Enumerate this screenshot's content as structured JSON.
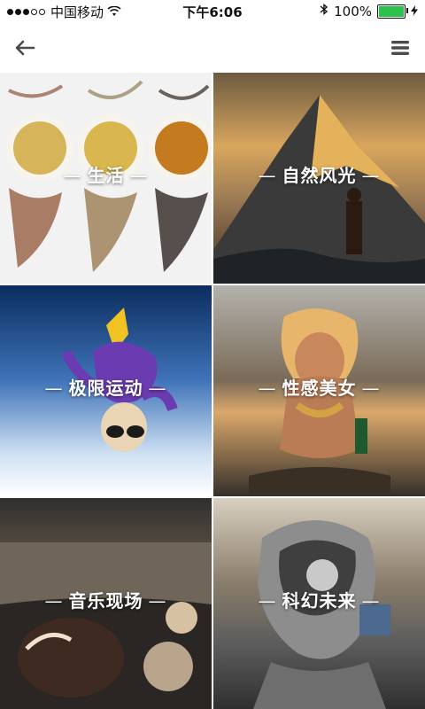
{
  "status_bar": {
    "carrier": "中国移动",
    "time": "下午6:06",
    "battery_percent": "100%",
    "battery_level": 1.0,
    "icons": [
      "signal-dots",
      "wifi",
      "bluetooth",
      "battery",
      "charging-bolt"
    ]
  },
  "nav": {
    "back_icon": "back-arrow-icon",
    "menu_icon": "menu-icon"
  },
  "categories": [
    {
      "label": "生活"
    },
    {
      "label": "自然风光"
    },
    {
      "label": "极限运动"
    },
    {
      "label": "性感美女"
    },
    {
      "label": "音乐现场"
    },
    {
      "label": "科幻未来"
    }
  ]
}
